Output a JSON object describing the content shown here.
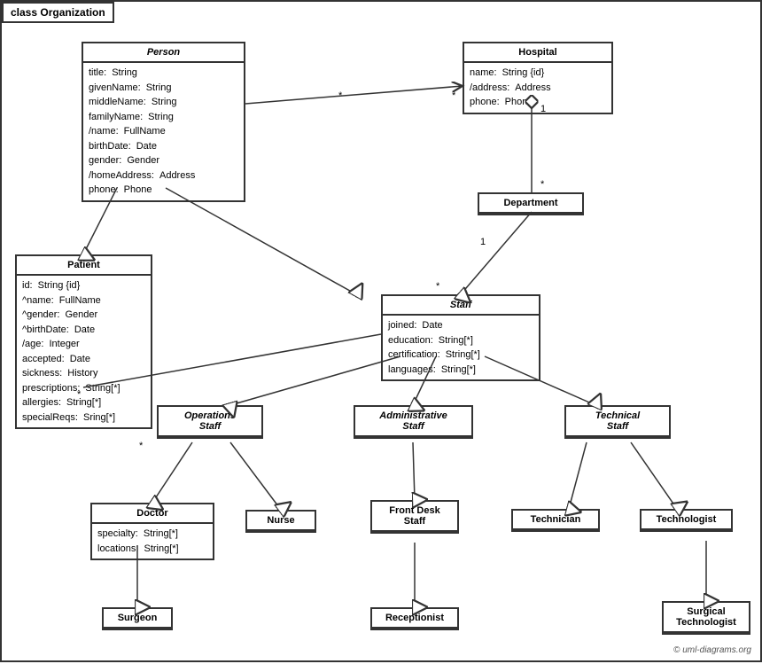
{
  "title": "class Organization",
  "classes": {
    "person": {
      "name": "Person",
      "italic": true,
      "attributes": [
        {
          "name": "title:",
          "type": "String"
        },
        {
          "name": "givenName:",
          "type": "String"
        },
        {
          "name": "middleName:",
          "type": "String"
        },
        {
          "name": "familyName:",
          "type": "String"
        },
        {
          "name": "/name:",
          "type": "FullName"
        },
        {
          "name": "birthDate:",
          "type": "Date"
        },
        {
          "name": "gender:",
          "type": "Gender"
        },
        {
          "name": "/homeAddress:",
          "type": "Address"
        },
        {
          "name": "phone:",
          "type": "Phone"
        }
      ]
    },
    "hospital": {
      "name": "Hospital",
      "italic": false,
      "attributes": [
        {
          "name": "name:",
          "type": "String {id}"
        },
        {
          "name": "/address:",
          "type": "Address"
        },
        {
          "name": "phone:",
          "type": "Phone"
        }
      ]
    },
    "department": {
      "name": "Department",
      "italic": false,
      "attributes": []
    },
    "staff": {
      "name": "Staff",
      "italic": true,
      "attributes": [
        {
          "name": "joined:",
          "type": "Date"
        },
        {
          "name": "education:",
          "type": "String[*]"
        },
        {
          "name": "certification:",
          "type": "String[*]"
        },
        {
          "name": "languages:",
          "type": "String[*]"
        }
      ]
    },
    "patient": {
      "name": "Patient",
      "italic": false,
      "attributes": [
        {
          "name": "id:",
          "type": "String {id}"
        },
        {
          "name": "^name:",
          "type": "FullName"
        },
        {
          "name": "^gender:",
          "type": "Gender"
        },
        {
          "name": "^birthDate:",
          "type": "Date"
        },
        {
          "name": "/age:",
          "type": "Integer"
        },
        {
          "name": "accepted:",
          "type": "Date"
        },
        {
          "name": "sickness:",
          "type": "History"
        },
        {
          "name": "prescriptions:",
          "type": "String[*]"
        },
        {
          "name": "allergies:",
          "type": "String[*]"
        },
        {
          "name": "specialReqs:",
          "type": "Sring[*]"
        }
      ]
    },
    "operations_staff": {
      "name": "Operations\nStaff",
      "italic": true,
      "attributes": []
    },
    "administrative_staff": {
      "name": "Administrative\nStaff",
      "italic": true,
      "attributes": []
    },
    "technical_staff": {
      "name": "Technical\nStaff",
      "italic": true,
      "attributes": []
    },
    "doctor": {
      "name": "Doctor",
      "italic": false,
      "attributes": [
        {
          "name": "specialty:",
          "type": "String[*]"
        },
        {
          "name": "locations:",
          "type": "String[*]"
        }
      ]
    },
    "nurse": {
      "name": "Nurse",
      "italic": false,
      "attributes": []
    },
    "front_desk_staff": {
      "name": "Front Desk\nStaff",
      "italic": false,
      "attributes": []
    },
    "technician": {
      "name": "Technician",
      "italic": false,
      "attributes": []
    },
    "technologist": {
      "name": "Technologist",
      "italic": false,
      "attributes": []
    },
    "surgeon": {
      "name": "Surgeon",
      "italic": false,
      "attributes": []
    },
    "receptionist": {
      "name": "Receptionist",
      "italic": false,
      "attributes": []
    },
    "surgical_technologist": {
      "name": "Surgical\nTechnologist",
      "italic": false,
      "attributes": []
    }
  },
  "copyright": "© uml-diagrams.org"
}
